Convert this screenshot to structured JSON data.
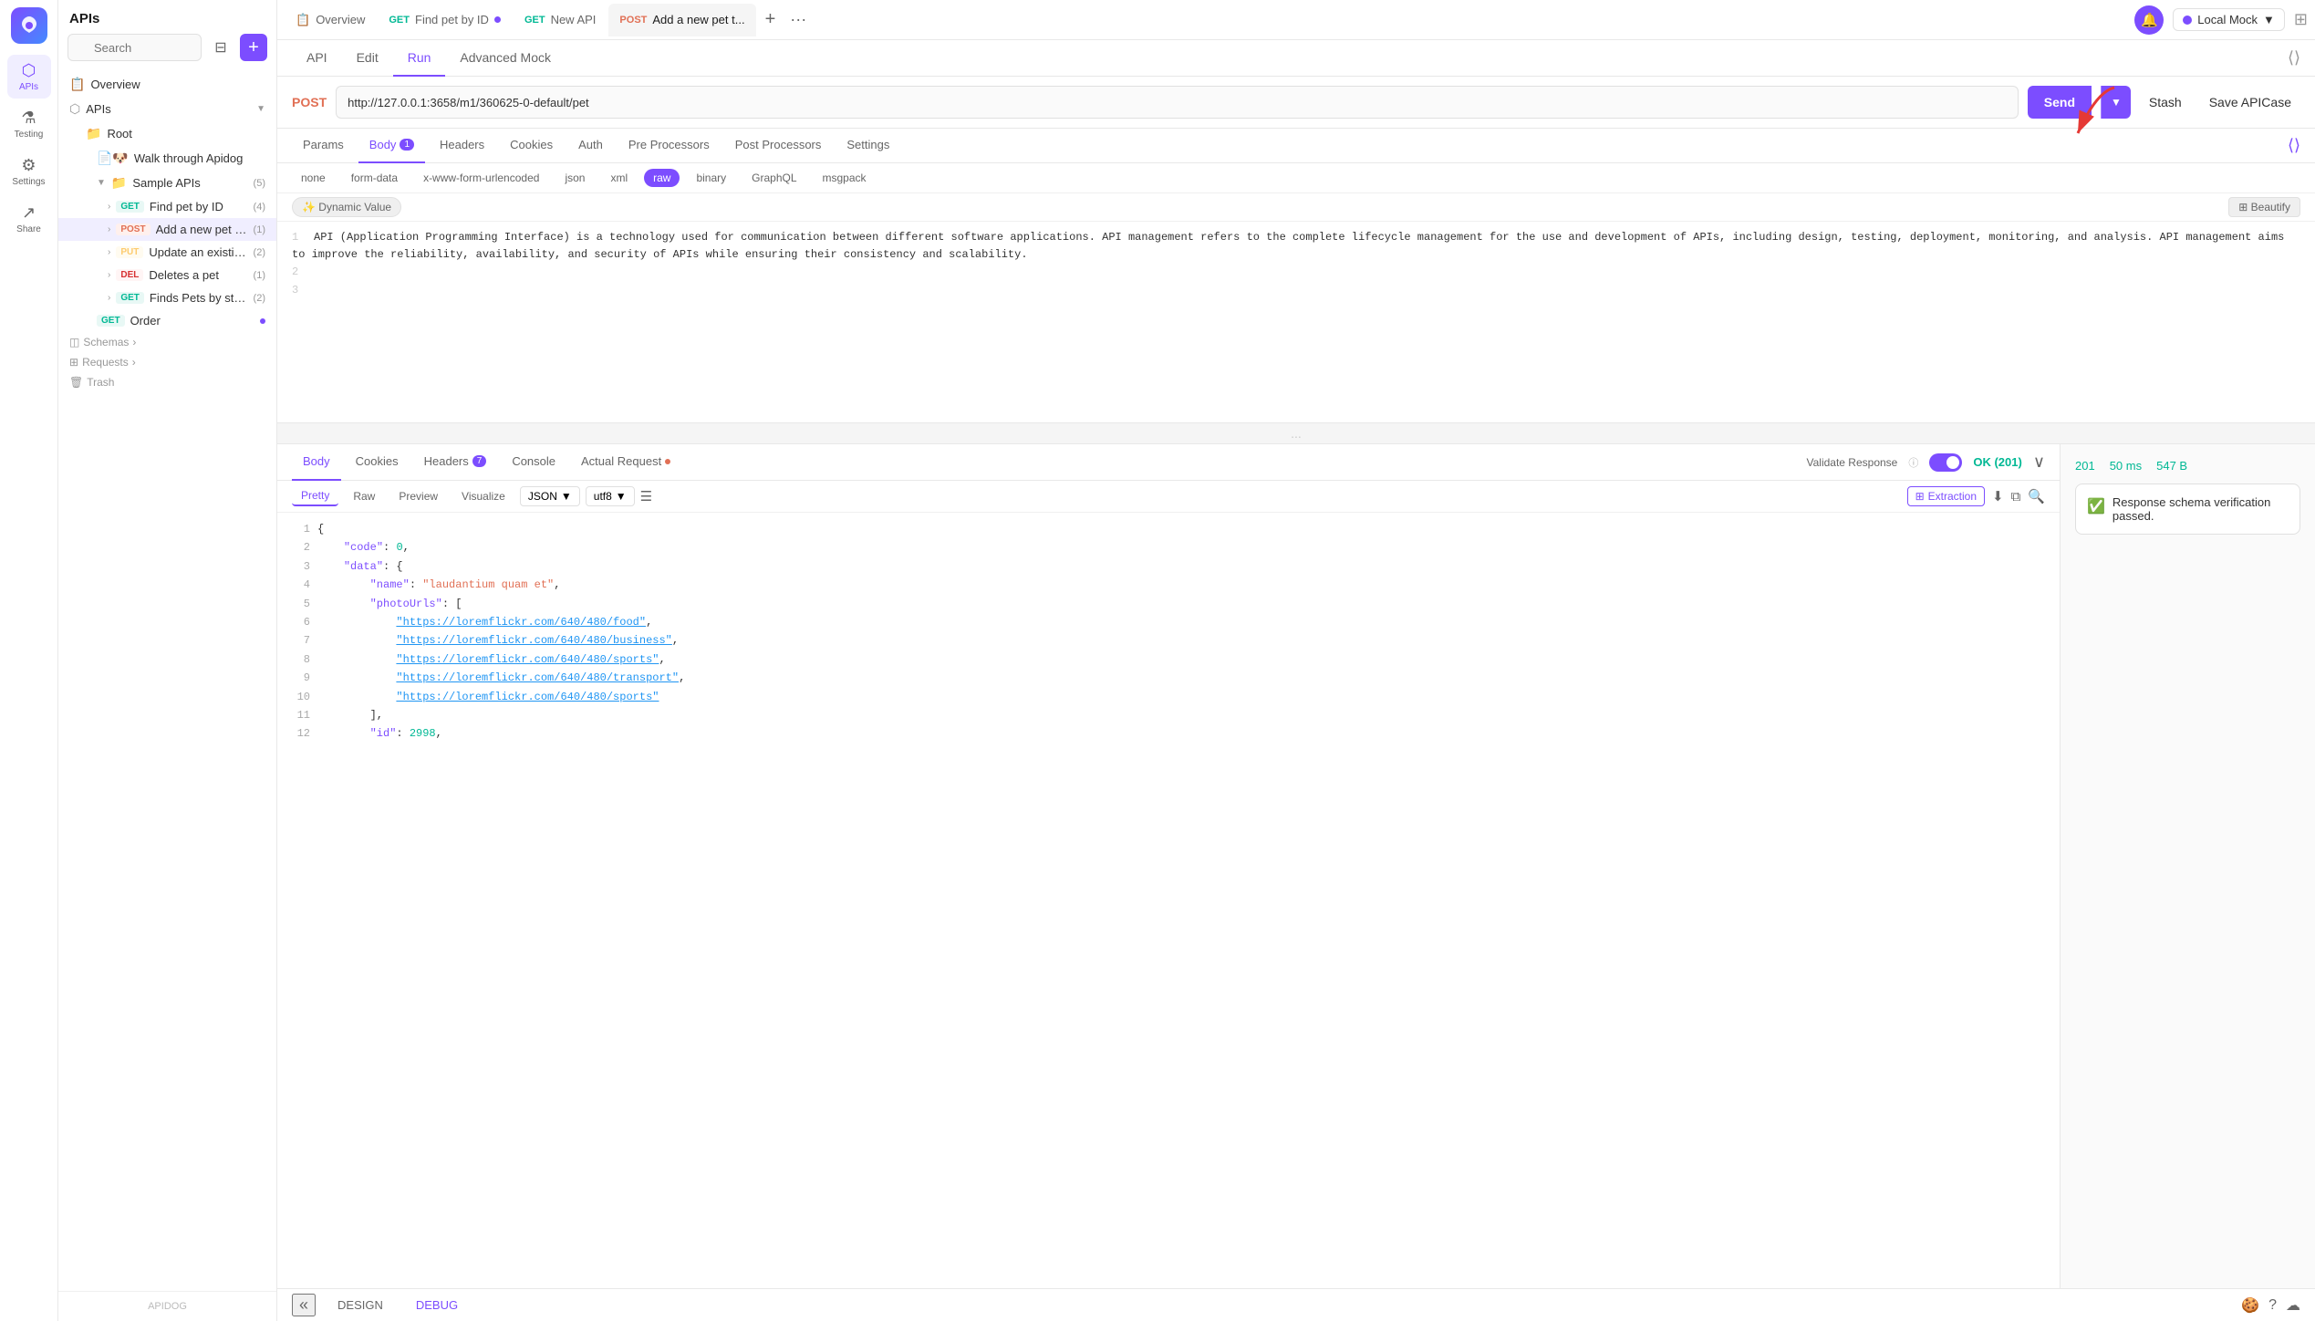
{
  "app": {
    "name": "APIs",
    "logo_color": "#7c4dff"
  },
  "icon_bar": {
    "items": [
      {
        "id": "apis",
        "label": "APIs",
        "icon": "⬡",
        "active": true
      },
      {
        "id": "testing",
        "label": "Testing",
        "icon": "⚗",
        "active": false
      },
      {
        "id": "settings",
        "label": "Settings",
        "icon": "⚙",
        "active": false
      },
      {
        "id": "share",
        "label": "Share",
        "icon": "↗",
        "active": false
      }
    ]
  },
  "sidebar": {
    "search_placeholder": "Search",
    "items": [
      {
        "id": "overview",
        "label": "Overview",
        "icon": "📋",
        "indent": 0
      },
      {
        "id": "apis",
        "label": "APIs",
        "icon": "⬡",
        "indent": 0
      },
      {
        "id": "root",
        "label": "Root",
        "indent": 1
      },
      {
        "id": "walthrough",
        "label": "Walk through Apidog",
        "indent": 2
      },
      {
        "id": "sample-apis",
        "label": "Sample APIs",
        "count": "(5)",
        "indent": 2
      },
      {
        "id": "find-pet",
        "method": "GET",
        "label": "Find pet by ID",
        "count": "(4)",
        "indent": 3
      },
      {
        "id": "add-pet",
        "method": "POST",
        "label": "Add a new pet to the store",
        "count": "(1)",
        "indent": 3,
        "active": true
      },
      {
        "id": "update-pet",
        "method": "PUT",
        "label": "Update an existing pet",
        "count": "(2)",
        "indent": 3
      },
      {
        "id": "deletes-pet",
        "method": "DEL",
        "label": "Deletes a pet",
        "count": "(1)",
        "indent": 3
      },
      {
        "id": "finds-pets",
        "method": "GET",
        "label": "Finds Pets by status",
        "count": "(2)",
        "indent": 3
      },
      {
        "id": "order",
        "method": "GET",
        "label": "Order",
        "indent": 2,
        "dot": true
      }
    ],
    "sections": [
      {
        "id": "schemas",
        "label": "Schemas"
      },
      {
        "id": "requests",
        "label": "Requests"
      },
      {
        "id": "trash",
        "label": "Trash"
      }
    ],
    "footer": "APIDOG"
  },
  "tabs": [
    {
      "id": "overview",
      "label": "Overview",
      "icon": "📋"
    },
    {
      "id": "get-find-pet",
      "method": "GET",
      "label": "Find pet by ID",
      "active": false,
      "dot": true
    },
    {
      "id": "get-new-api",
      "method": "GET",
      "label": "New API",
      "active": false
    },
    {
      "id": "post-add-pet",
      "method": "POST",
      "label": "Add a new pet t...",
      "active": true
    }
  ],
  "env": {
    "label": "Local Mock",
    "color": "#7c4dff"
  },
  "sub_tabs": [
    {
      "id": "api",
      "label": "API"
    },
    {
      "id": "edit",
      "label": "Edit"
    },
    {
      "id": "run",
      "label": "Run",
      "active": true
    },
    {
      "id": "advanced-mock",
      "label": "Advanced Mock"
    }
  ],
  "url_bar": {
    "method": "POST",
    "url": "http://127.0.0.1:3658/m1/360625-0-default/pet",
    "send_label": "Send",
    "stash_label": "Stash",
    "save_label": "Save APICase"
  },
  "req_tabs": [
    {
      "id": "params",
      "label": "Params"
    },
    {
      "id": "body",
      "label": "Body",
      "count": "1",
      "active": true
    },
    {
      "id": "headers",
      "label": "Headers"
    },
    {
      "id": "cookies",
      "label": "Cookies"
    },
    {
      "id": "auth",
      "label": "Auth"
    },
    {
      "id": "pre-processors",
      "label": "Pre Processors"
    },
    {
      "id": "post-processors",
      "label": "Post Processors"
    },
    {
      "id": "settings",
      "label": "Settings"
    }
  ],
  "body_types": [
    {
      "id": "none",
      "label": "none"
    },
    {
      "id": "form-data",
      "label": "form-data"
    },
    {
      "id": "x-www-form-urlencoded",
      "label": "x-www-form-urlencoded"
    },
    {
      "id": "json",
      "label": "json"
    },
    {
      "id": "xml",
      "label": "xml"
    },
    {
      "id": "raw",
      "label": "raw",
      "active": true
    },
    {
      "id": "binary",
      "label": "binary"
    },
    {
      "id": "graphql",
      "label": "GraphQL"
    },
    {
      "id": "msgpack",
      "label": "msgpack"
    }
  ],
  "dynamic_value_btn": "✨ Dynamic Value",
  "beautify_btn": "⊞ Beautify",
  "code_content": "API (Application Programming Interface) is a technology used for communication between different software applications. API management refers to the complete lifecycle management for the use and development of APIs, including design, testing, deployment, monitoring, and analysis. API management aims to improve the reliability, availability, and security of APIs while ensuring their consistency and scalability.",
  "separator": "...",
  "resp_tabs": [
    {
      "id": "body",
      "label": "Body",
      "active": true
    },
    {
      "id": "cookies",
      "label": "Cookies"
    },
    {
      "id": "headers",
      "label": "Headers",
      "count": "7"
    },
    {
      "id": "console",
      "label": "Console"
    },
    {
      "id": "actual-request",
      "label": "Actual Request",
      "dot": true
    }
  ],
  "validate_response": "Validate Response",
  "status_ok": "OK (201)",
  "resp_formats": [
    {
      "id": "pretty",
      "label": "Pretty",
      "active": true
    },
    {
      "id": "raw",
      "label": "Raw"
    },
    {
      "id": "preview",
      "label": "Preview"
    },
    {
      "id": "visualize",
      "label": "Visualize"
    }
  ],
  "json_selector": "JSON",
  "encoding_selector": "utf8",
  "extraction_btn": "Extraction",
  "stats": {
    "code": "201",
    "time": "50 ms",
    "size": "547 B"
  },
  "verification": {
    "text": "Response schema verification passed."
  },
  "json_response": [
    {
      "line": 1,
      "content": "{"
    },
    {
      "line": 2,
      "content": "    \"code\": 0,"
    },
    {
      "line": 3,
      "content": "    \"data\": {"
    },
    {
      "line": 4,
      "content": "        \"name\": \"laudantium quam et\","
    },
    {
      "line": 5,
      "content": "        \"photoUrls\": ["
    },
    {
      "line": 6,
      "content": "            \"https://loremflickr.com/640/480/food\","
    },
    {
      "line": 7,
      "content": "            \"https://loremflickr.com/640/480/business\","
    },
    {
      "line": 8,
      "content": "            \"https://loremflickr.com/640/480/sports\","
    },
    {
      "line": 9,
      "content": "            \"https://loremflickr.com/640/480/transport\","
    },
    {
      "line": 10,
      "content": "            \"https://loremflickr.com/640/480/sports\""
    },
    {
      "line": 11,
      "content": "        ],"
    },
    {
      "line": 12,
      "content": "        \"id\": 2998,"
    }
  ],
  "bottom_bar": {
    "nav_back": "«",
    "design_btn": "DESIGN",
    "debug_btn": "DEBUG",
    "right_icons": [
      "🍪",
      "?",
      "☁"
    ]
  }
}
